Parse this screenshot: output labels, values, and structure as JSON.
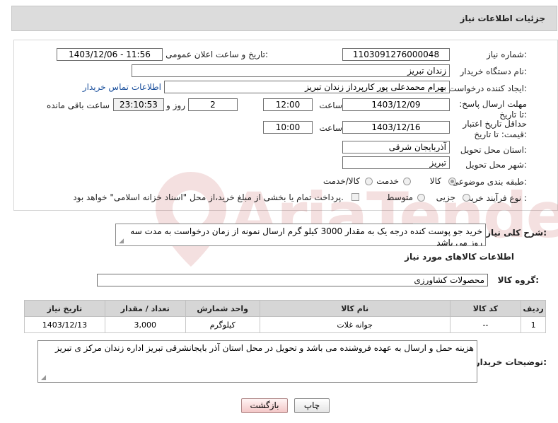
{
  "header": {
    "title": "جزئیات اطلاعات نیاز"
  },
  "need_number": {
    "label": "شماره نیاز:",
    "value": "1103091276000048"
  },
  "announce_datetime": {
    "label": "تاریخ و ساعت اعلان عمومی:",
    "value": "1403/12/06 - 11:56"
  },
  "buyer_org": {
    "label": "نام دستگاه خریدار:",
    "value": "زندان تبریز"
  },
  "requester": {
    "label": "ایجاد کننده درخواست:",
    "value": "بهرام محمدعلی پور کارپرداز زندان تبریز",
    "contact_link": "اطلاعات تماس خریدار"
  },
  "reply_deadline": {
    "label": "مهلت ارسال پاسخ: تا تاریخ:",
    "date": "1403/12/09",
    "time_label": "ساعت",
    "time": "12:00",
    "days": "2",
    "days_label": "روز و",
    "remaining": "23:10:53",
    "remaining_label": "ساعت باقی مانده"
  },
  "price_validity": {
    "label": "حداقل تاریخ اعتبار قیمت: تا تاریخ:",
    "date": "1403/12/16",
    "time_label": "ساعت",
    "time": "10:00"
  },
  "delivery_province": {
    "label": "استان محل تحویل:",
    "value": "آذربایجان شرقی"
  },
  "delivery_city": {
    "label": "شهر محل تحویل:",
    "value": "تبریز"
  },
  "category": {
    "label": "طبقه بندی موضوعی:",
    "options": [
      "کالا",
      "خدمت",
      "کالا/خدمت"
    ],
    "selected": "کالا"
  },
  "purchase_process": {
    "label": "نوع فرآیند خرید :",
    "options": [
      "جزیی",
      "متوسط"
    ],
    "payment_note": "پرداخت تمام یا بخشی از مبلغ خرید،از محل \"اسناد خزانه اسلامی\" خواهد بود."
  },
  "description": {
    "label": "شرح کلی نیاز:",
    "value": "خرید جو پوست کنده درجه یک به مقدار 3000 کیلو گرم ارسال نمونه از زمان درخواست به مدت سه روز می باشد"
  },
  "items_section": {
    "title": "اطلاعات کالاهای مورد نیاز"
  },
  "goods_group": {
    "label": "گروه کالا:",
    "value": "محصولات کشاورزی"
  },
  "items_table": {
    "headers": [
      "ردیف",
      "کد کالا",
      "نام کالا",
      "واحد شمارش",
      "تعداد / مقدار",
      "تاریخ نیاز"
    ],
    "rows": [
      [
        "1",
        "--",
        "جوانه غلات",
        "کیلوگرم",
        "3,000",
        "1403/12/13"
      ]
    ]
  },
  "buyer_notes": {
    "label": "توضیحات خریدار:",
    "value": "هزینه حمل و ارسال به عهده فروشنده می باشد و تحویل در محل استان آذر بایجانشرقی تبریز اداره زندان مرکز ی تبریز"
  },
  "buttons": {
    "print": "چاپ",
    "back": "بازگشت"
  },
  "colors": {
    "header_bg": "#dcdcdc",
    "table_header_bg": "#d6d6d6",
    "link": "#1a4f9c",
    "back_button": "#f3c6c6",
    "watermark": "#b21d1d"
  }
}
